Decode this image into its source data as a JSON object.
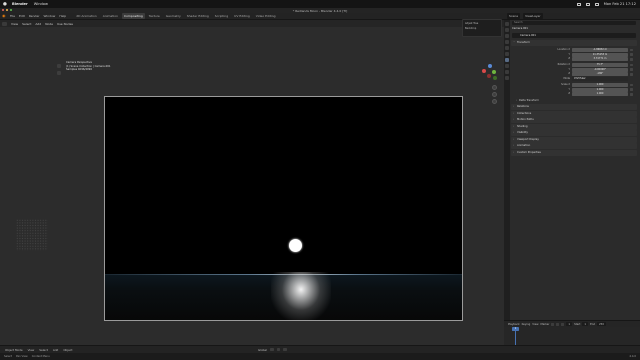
{
  "os_menubar": {
    "app_name": "Blender",
    "window_menu": "Window",
    "clock": "Mon Feb 21 17:12"
  },
  "window": {
    "title": "* Redlands Moon - Blender 4.4.0 [TI]"
  },
  "topbar": {
    "menus": [
      "File",
      "Edit",
      "Render",
      "Window",
      "Help"
    ],
    "workspaces": [
      "2D Animation",
      "Animation",
      "Compositing",
      "Texture",
      "Geometry",
      "Shader Editing",
      "Scripting",
      "UV Editing",
      "Video Editing"
    ],
    "active_workspace": "Compositing"
  },
  "scene_strip": {
    "scene": "Scene",
    "view_layer": "ViewLayer"
  },
  "viewport_header": {
    "menus": [
      "View",
      "Select",
      "Add",
      "Node",
      "Use Nodes"
    ]
  },
  "viewport_info": {
    "line1": "Camera Perspective",
    "line2": "(1) Scene Collection | Camera.001",
    "line3": "Samples 4096/4096"
  },
  "op_panel": {
    "title": "Adjust Tree",
    "row1": "Backdrop"
  },
  "properties": {
    "search_placeholder": "Search",
    "object_name": "Camera.001",
    "object_field": "Camera.001",
    "transform_label": "Transform",
    "rows": [
      {
        "label": "Location X",
        "value": "-1.86832 m"
      },
      {
        "label": "Y",
        "value": "11.35153 m"
      },
      {
        "label": "Z",
        "value": "3.74771 m"
      },
      {
        "label": "Rotation X",
        "value": "75.7°"
      },
      {
        "label": "Y",
        "value": "-0.00000°"
      },
      {
        "label": "Z",
        "value": "-180°"
      },
      {
        "label": "Mode",
        "value": "XYZ Euler"
      },
      {
        "label": "Scale X",
        "value": "1.000"
      },
      {
        "label": "Y",
        "value": "1.000"
      },
      {
        "label": "Z",
        "value": "1.000"
      }
    ],
    "subsection": "Delta Transform",
    "sections": [
      "Relations",
      "Collections",
      "Motion Paths",
      "Shading",
      "Visibility",
      "Viewport Display",
      "Animation",
      "Custom Properties"
    ]
  },
  "timeline": {
    "menus": [
      "Playback",
      "Keying",
      "View",
      "Marker"
    ],
    "current_frame": "1",
    "start_label": "Start",
    "start": "1",
    "end_label": "End",
    "end": "250"
  },
  "viewport_footer": {
    "menus": [
      "Object Mode",
      "View",
      "Select",
      "Add",
      "Object"
    ],
    "global_label": "Global"
  },
  "statusbar": {
    "items": [
      "Select",
      "Pan View",
      "Context Menu"
    ],
    "version": "4.4.0"
  },
  "colors": {
    "accent": "#4772b3",
    "orange": "#e87d0d",
    "bg": "#2c2c2c"
  }
}
